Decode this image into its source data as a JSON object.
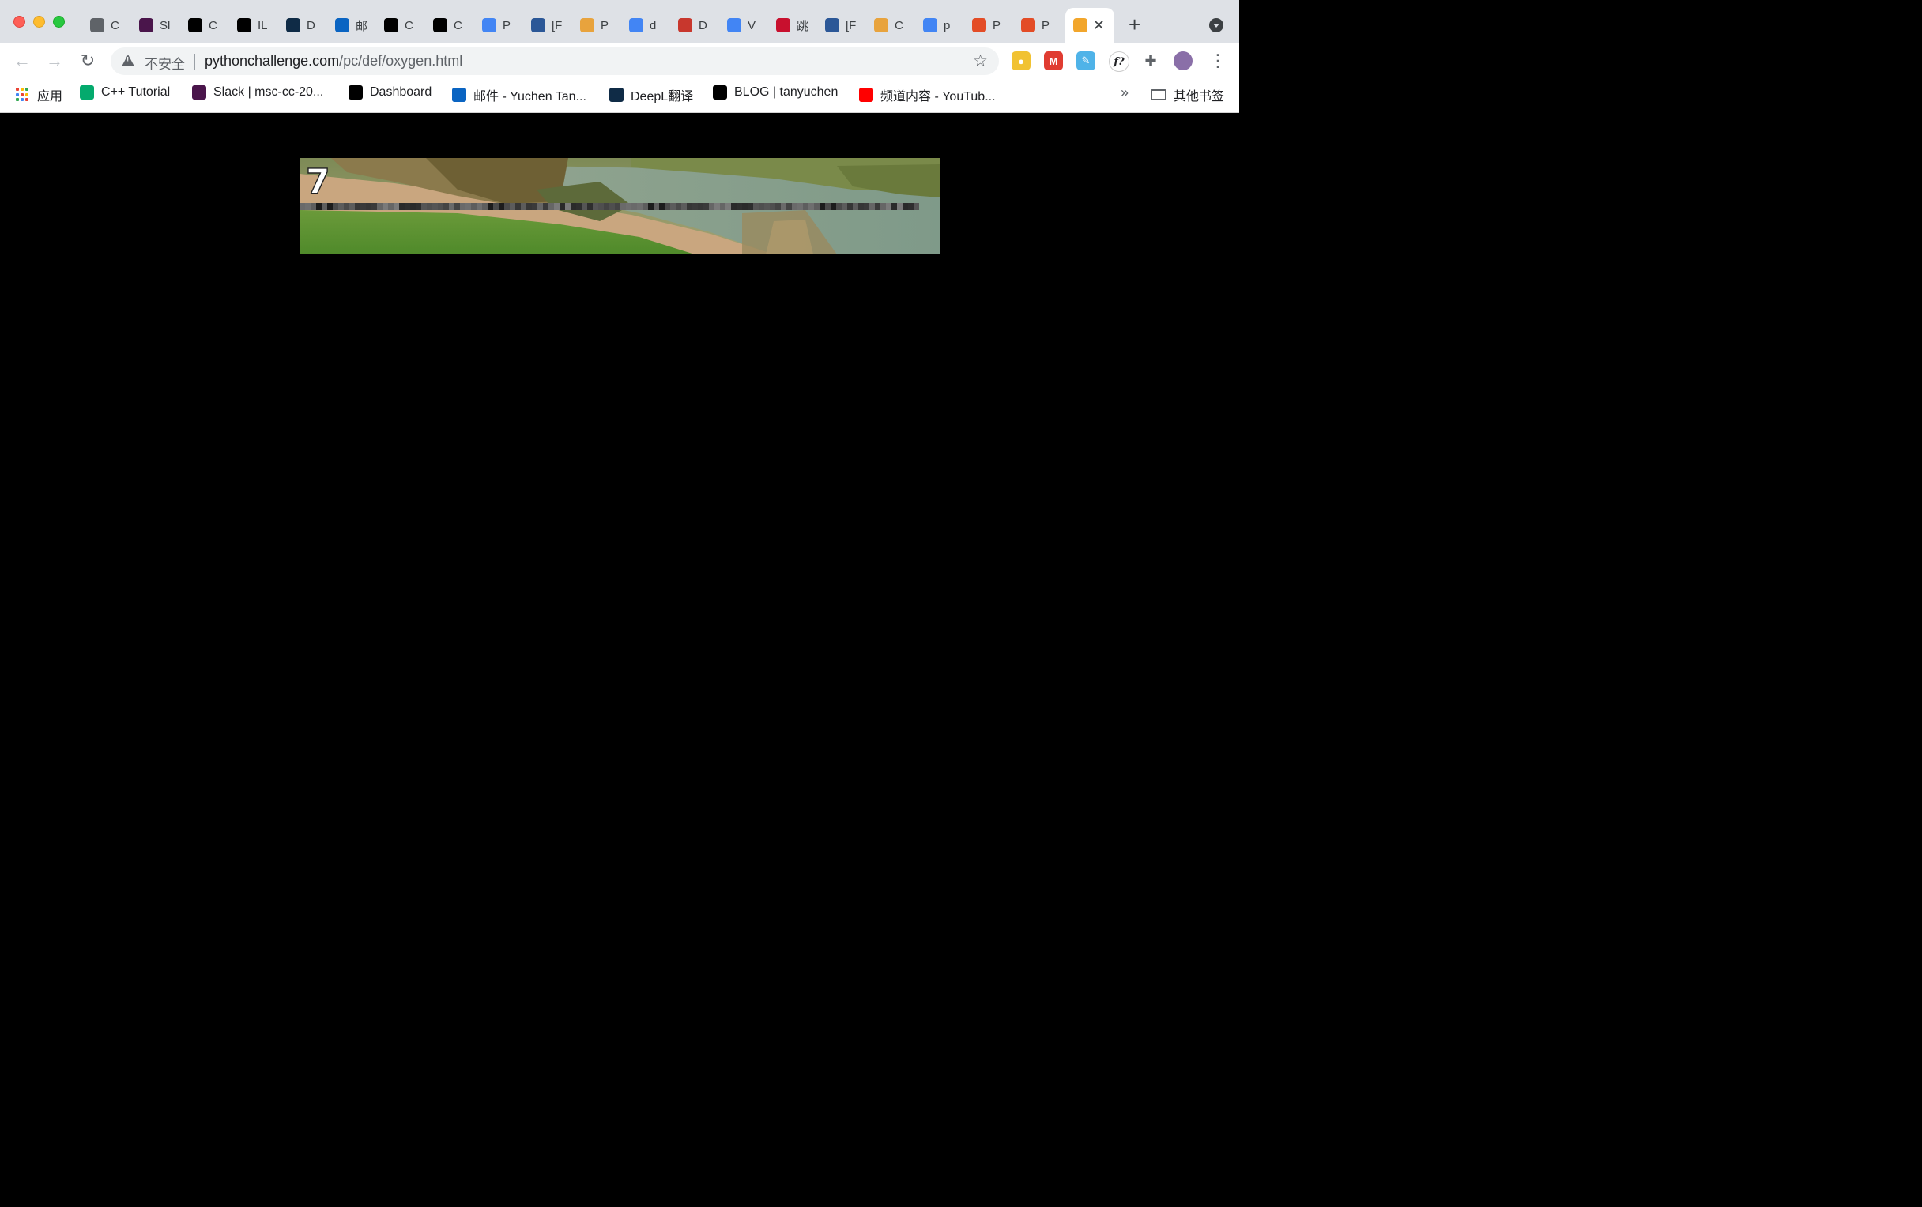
{
  "window": {
    "tabs": [
      {
        "title": "C",
        "icon": "globe-icon",
        "color": "#5f6368"
      },
      {
        "title": "Sl",
        "icon": "slack-icon",
        "color": "#4a154b"
      },
      {
        "title": "C",
        "icon": "qr-block-icon",
        "color": "#000000"
      },
      {
        "title": "IL",
        "icon": "qr-block-icon",
        "color": "#000000"
      },
      {
        "title": "D",
        "icon": "deepl-icon",
        "color": "#0f2b46"
      },
      {
        "title": "邮",
        "icon": "outlook-icon",
        "color": "#0a64c2"
      },
      {
        "title": "C",
        "icon": "github-icon",
        "color": "#000000"
      },
      {
        "title": "C",
        "icon": "qr-block-icon",
        "color": "#000000"
      },
      {
        "title": "P",
        "icon": "google-icon",
        "color": "#4285f4"
      },
      {
        "title": "[F",
        "icon": "kite-icon",
        "color": "#2b5797"
      },
      {
        "title": "P",
        "icon": "bowl-icon",
        "color": "#e8a33d"
      },
      {
        "title": "d",
        "icon": "google-icon",
        "color": "#4285f4"
      },
      {
        "title": "D",
        "icon": "leaf-icon",
        "color": "#c8372d"
      },
      {
        "title": "V",
        "icon": "google-icon",
        "color": "#4285f4"
      },
      {
        "title": "跳",
        "icon": "tue-icon",
        "color": "#c8102e"
      },
      {
        "title": "[F",
        "icon": "kite-icon",
        "color": "#2b5797"
      },
      {
        "title": "C",
        "icon": "bowl-icon",
        "color": "#e8a33d"
      },
      {
        "title": "p",
        "icon": "google-icon",
        "color": "#4285f4"
      },
      {
        "title": "P",
        "icon": "c-logo-icon",
        "color": "#e34c26"
      },
      {
        "title": "P",
        "icon": "c-logo-icon",
        "color": "#e34c26"
      },
      {
        "title": "",
        "icon": "pythonchallenge-icon",
        "color": "#f2a62c",
        "active": true
      }
    ]
  },
  "toolbar": {
    "security_label": "不安全",
    "url_host": "pythonchallenge.com",
    "url_path": "/pc/def/oxygen.html"
  },
  "bookmarks": [
    {
      "label": "应用",
      "icon": "apps-grid-icon"
    },
    {
      "label": "C++ Tutorial",
      "icon": "w3schools-icon",
      "color": "#04aa6d"
    },
    {
      "label": "Slack | msc-cc-20...",
      "icon": "slack-icon",
      "color": "#4a154b"
    },
    {
      "label": "Dashboard",
      "icon": "qr-block-icon",
      "color": "#000000"
    },
    {
      "label": "邮件 - Yuchen Tan...",
      "icon": "outlook-icon",
      "color": "#0a64c2"
    },
    {
      "label": "DeepL翻译",
      "icon": "deepl-icon",
      "color": "#0f2b46"
    },
    {
      "label": "BLOG | tanyuchen",
      "icon": "wix-icon",
      "color": "#000000"
    },
    {
      "label": "频道内容 - YouTub...",
      "icon": "youtube-icon",
      "color": "#ff0000"
    }
  ],
  "other_bookmarks_label": "其他书签",
  "page": {
    "level_number": "7",
    "background": "#000000"
  }
}
